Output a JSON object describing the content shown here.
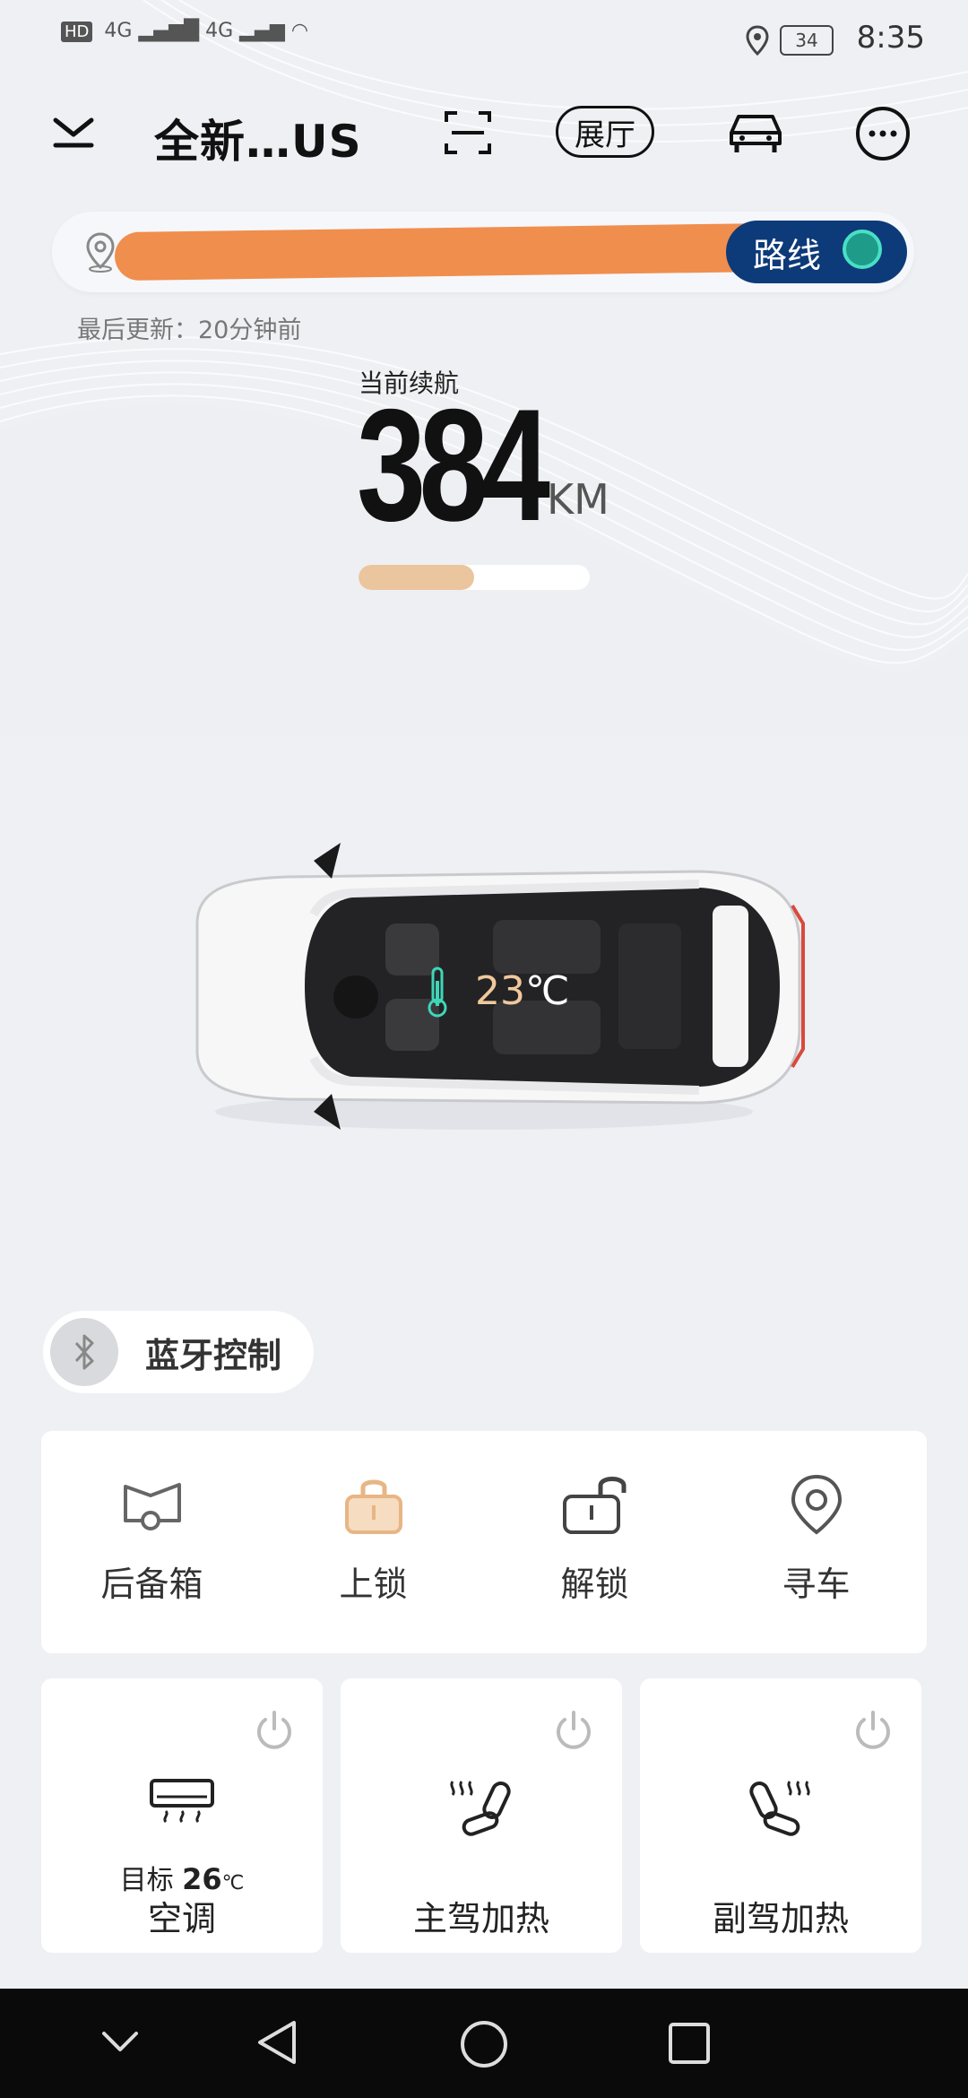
{
  "status_bar": {
    "time": "8:35",
    "battery": "34",
    "network": "HD 4G 4G"
  },
  "header": {
    "title": "全新…US",
    "hall_label": "展厅"
  },
  "location": {
    "route_label": "路线"
  },
  "updated_text": "最后更新：20分钟前",
  "range": {
    "label": "当前续航",
    "value": "384",
    "unit": "KM",
    "fill_fraction": 0.5
  },
  "car": {
    "temp_value": "23",
    "temp_unit": "℃"
  },
  "bluetooth": {
    "label": "蓝牙控制"
  },
  "actions": [
    {
      "label": "后备箱",
      "icon": "trunk-icon"
    },
    {
      "label": "上锁",
      "icon": "lock-icon"
    },
    {
      "label": "解锁",
      "icon": "unlock-icon"
    },
    {
      "label": "寻车",
      "icon": "find-car-icon"
    }
  ],
  "climate": [
    {
      "label": "空调",
      "target_prefix": "目标",
      "target_value": "26",
      "target_unit": "℃",
      "icon": "ac-icon"
    },
    {
      "label": "主驾加热",
      "icon": "driver-seat-heat-icon"
    },
    {
      "label": "副驾加热",
      "icon": "passenger-seat-heat-icon"
    }
  ],
  "colors": {
    "accent_orange": "#ebc59e",
    "route_navy": "#0d3a78",
    "background": "#eff0f4"
  }
}
